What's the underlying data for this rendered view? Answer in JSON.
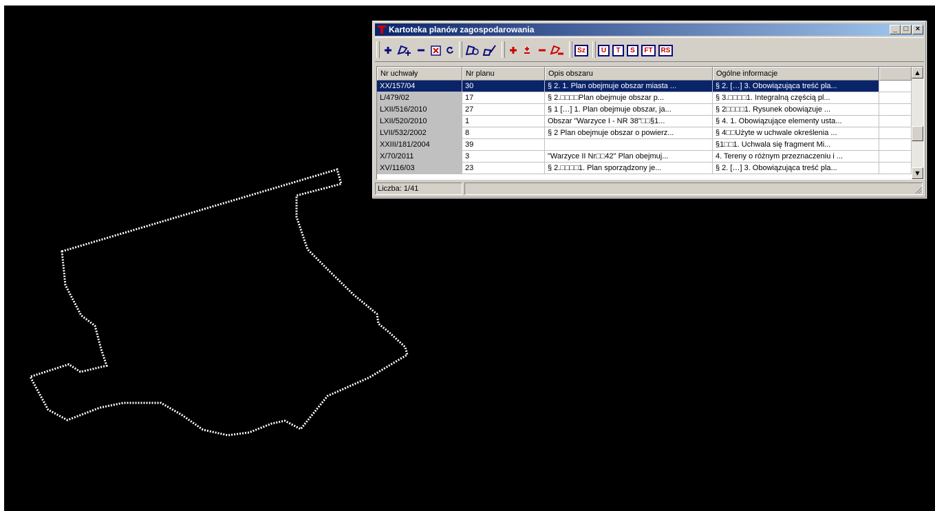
{
  "window": {
    "title": "Kartoteka planów zagospodarowania",
    "controls": [
      "_",
      "□",
      "×"
    ]
  },
  "toolbar": {
    "letter_buttons": [
      "Sz",
      "U",
      "T",
      "S",
      "FT",
      "RS"
    ]
  },
  "table": {
    "columns": [
      "Nr uchwały",
      "Nr planu",
      "Opis obszaru",
      "Ogólne informacje"
    ],
    "rows": [
      [
        "XX/157/04",
        "30",
        "§ 2. 1. Plan obejmuje obszar miasta ...",
        "§ 2. […] 3. Obowiązująca treść pla..."
      ],
      [
        "L/479/02",
        "17",
        "§ 2.□□□□Plan obejmuje obszar p...",
        "§ 3.□□□□1. Integralną częścią pl..."
      ],
      [
        "LXII/516/2010",
        "27",
        "§ 1 […] 1. Plan obejmuje obszar, ja...",
        "§ 2□□□□1. Rysunek obowiązuje ..."
      ],
      [
        "LXII/520/2010",
        "1",
        "Obszar \"Warzyce I - NR 38\"□□§1...",
        "§ 4.  1. Obowiązujące elementy usta..."
      ],
      [
        "LVII/532/2002",
        "8",
        "§ 2  Plan obejmuje obszar o powierz...",
        "§ 4□□Użyte w uchwale określenia ..."
      ],
      [
        "XXIII/181/2004",
        "39",
        "",
        "§1□□1. Uchwala się fragment  Mi..."
      ],
      [
        "X/70/2011",
        "3",
        "\"Warzyce II Nr□□42\" Plan obejmuj...",
        "4. Tereny o różnym przeznaczeniu i ..."
      ],
      [
        "XV/116/03",
        "23",
        "§ 2.□□□□1. Plan sporządzony je...",
        "§ 2. […] 3.  Obowiązująca treść pla..."
      ]
    ],
    "selected_row": 0
  },
  "status": {
    "count": "Liczba: 1/41",
    "message": ""
  },
  "colors": {
    "background": "#000000",
    "outline": "#ffffff",
    "window_face": "#d4d0c8",
    "title_start": "#0a246a",
    "title_end": "#a6caf0",
    "selection": "#0a246a",
    "icon_red": "#cc0000"
  },
  "icons": [
    "app-icon",
    "add-icon",
    "add-polygon-icon",
    "remove-icon",
    "delete-icon",
    "refresh-icon",
    "polygon-search-icon",
    "edit-geometry-icon",
    "plus-red-icon",
    "plusminus-red-icon",
    "minus-red-icon",
    "remove-polygon-red-icon"
  ]
}
